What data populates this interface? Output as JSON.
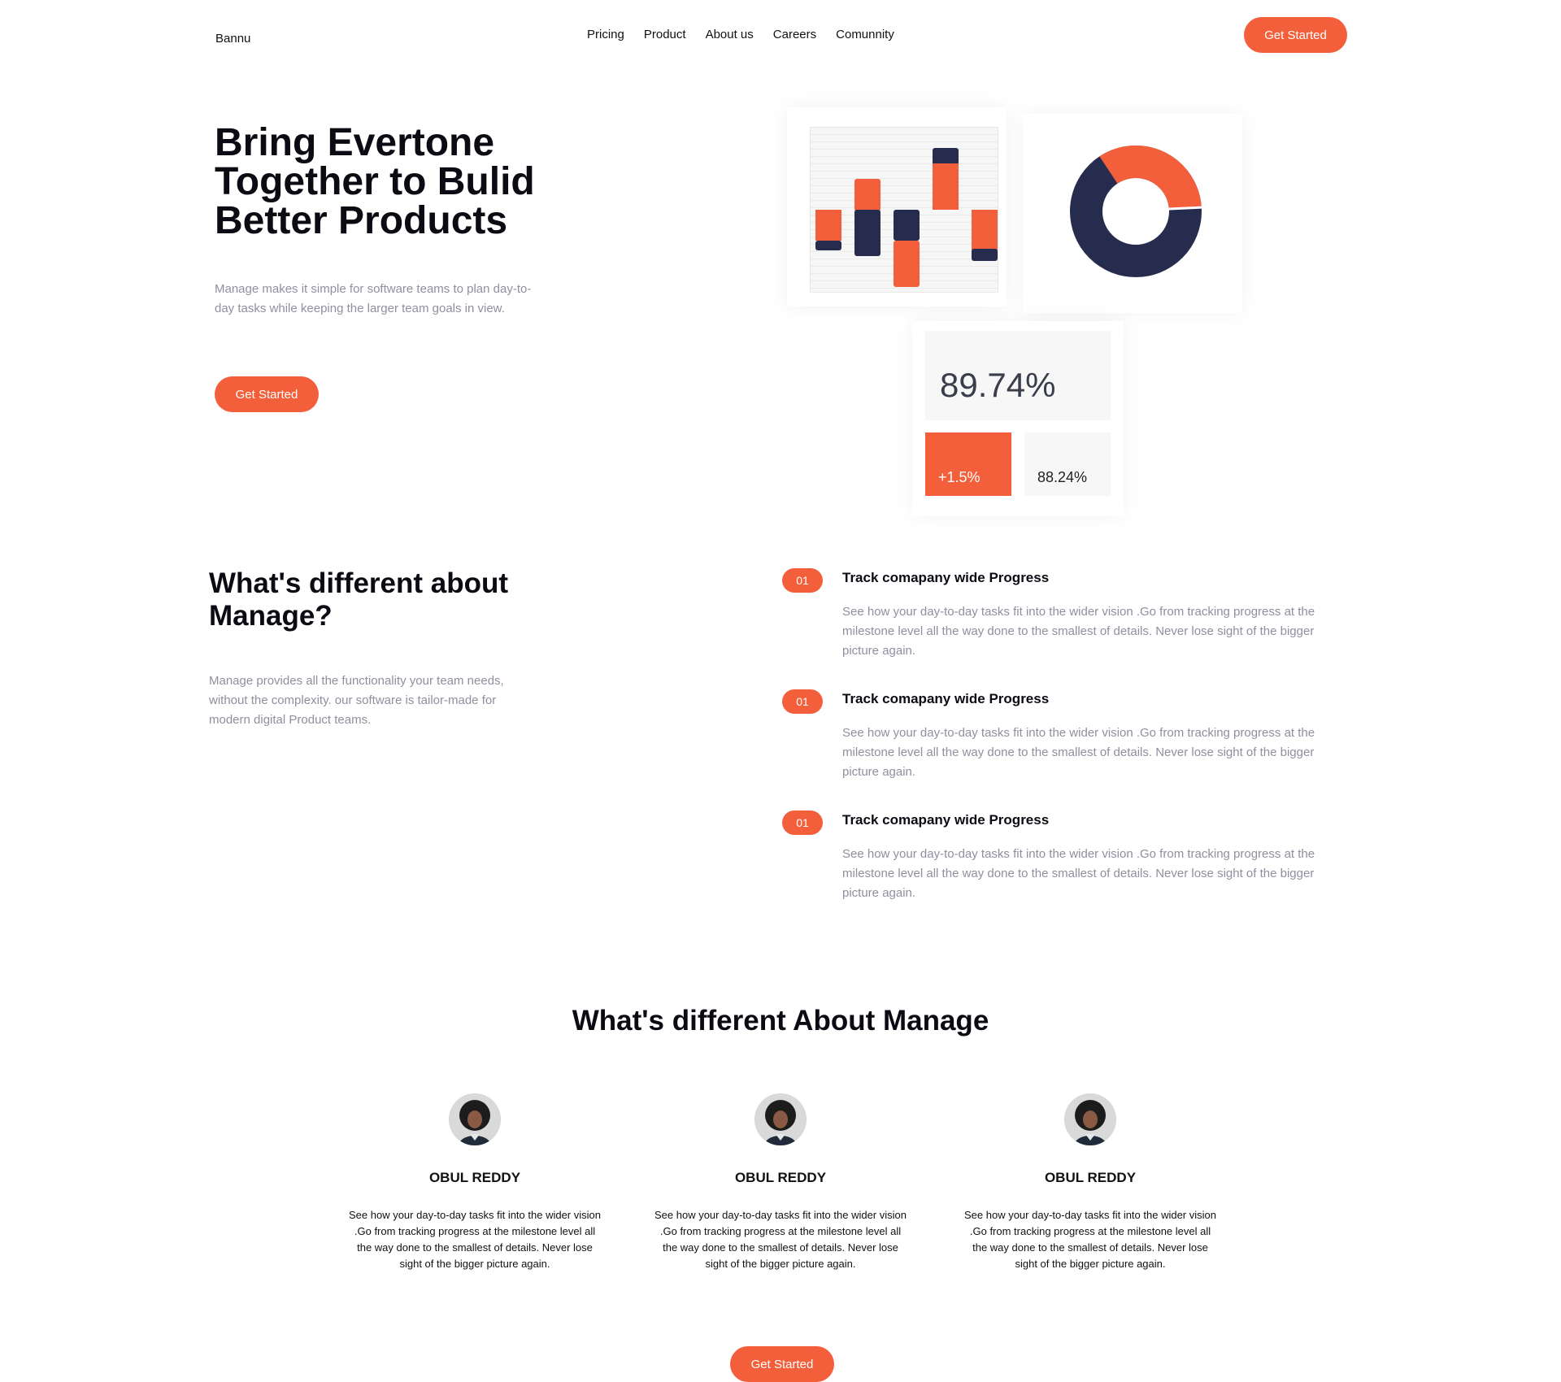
{
  "header": {
    "logo": "Bannu",
    "nav": [
      "Pricing",
      "Product",
      "About us",
      "Careers",
      "Comunnity"
    ],
    "cta": "Get Started"
  },
  "hero": {
    "title": "Bring Evertone Together to Bulid Better Products",
    "description": "Manage makes it simple for software teams to plan day-to-day tasks while keeping the larger team goals in view.",
    "cta": "Get Started"
  },
  "dashboard": {
    "main_stat": "89.74%",
    "change_stat": "+1.5%",
    "secondary_stat": "88.24%",
    "colors": {
      "accent": "#f45f3b",
      "navy": "#262c4e"
    }
  },
  "section2": {
    "title": "What's different about Manage?",
    "description": "Manage provides all the functionality your team needs, without the complexity. our software is tailor-made for modern digital Product teams.",
    "features": [
      {
        "number": "01",
        "title": "Track comapany wide Progress",
        "text": "See how your day-to-day tasks fit into the wider vision .Go from tracking progress at the milestone level all the way done to the smallest of details. Never lose sight of the bigger picture again."
      },
      {
        "number": "01",
        "title": "Track comapany wide Progress",
        "text": "See how your day-to-day tasks fit into the wider vision .Go from tracking progress at the milestone level all the way done to the smallest of details. Never lose sight of the bigger picture again."
      },
      {
        "number": "01",
        "title": "Track comapany wide Progress",
        "text": "See how your day-to-day tasks fit into the wider vision .Go from tracking progress at the milestone level all the way done to the smallest of details. Never lose sight of the bigger picture again."
      }
    ]
  },
  "section3": {
    "title": "What's different About Manage",
    "testimonials": [
      {
        "name": "OBUL REDDY",
        "text": "See how your day-to-day tasks fit into the wider vision .Go from tracking progress at the milestone level all the way done to the smallest of details. Never lose sight of the bigger picture again."
      },
      {
        "name": "OBUL REDDY",
        "text": "See how your day-to-day tasks fit into the wider vision .Go from tracking progress at the milestone level all the way done to the smallest of details. Never lose sight of the bigger picture again."
      },
      {
        "name": "OBUL REDDY",
        "text": "See how your day-to-day tasks fit into the wider vision .Go from tracking progress at the milestone level all the way done to the smallest of details. Never lose sight of the bigger picture again."
      }
    ],
    "cta": "Get Started"
  }
}
